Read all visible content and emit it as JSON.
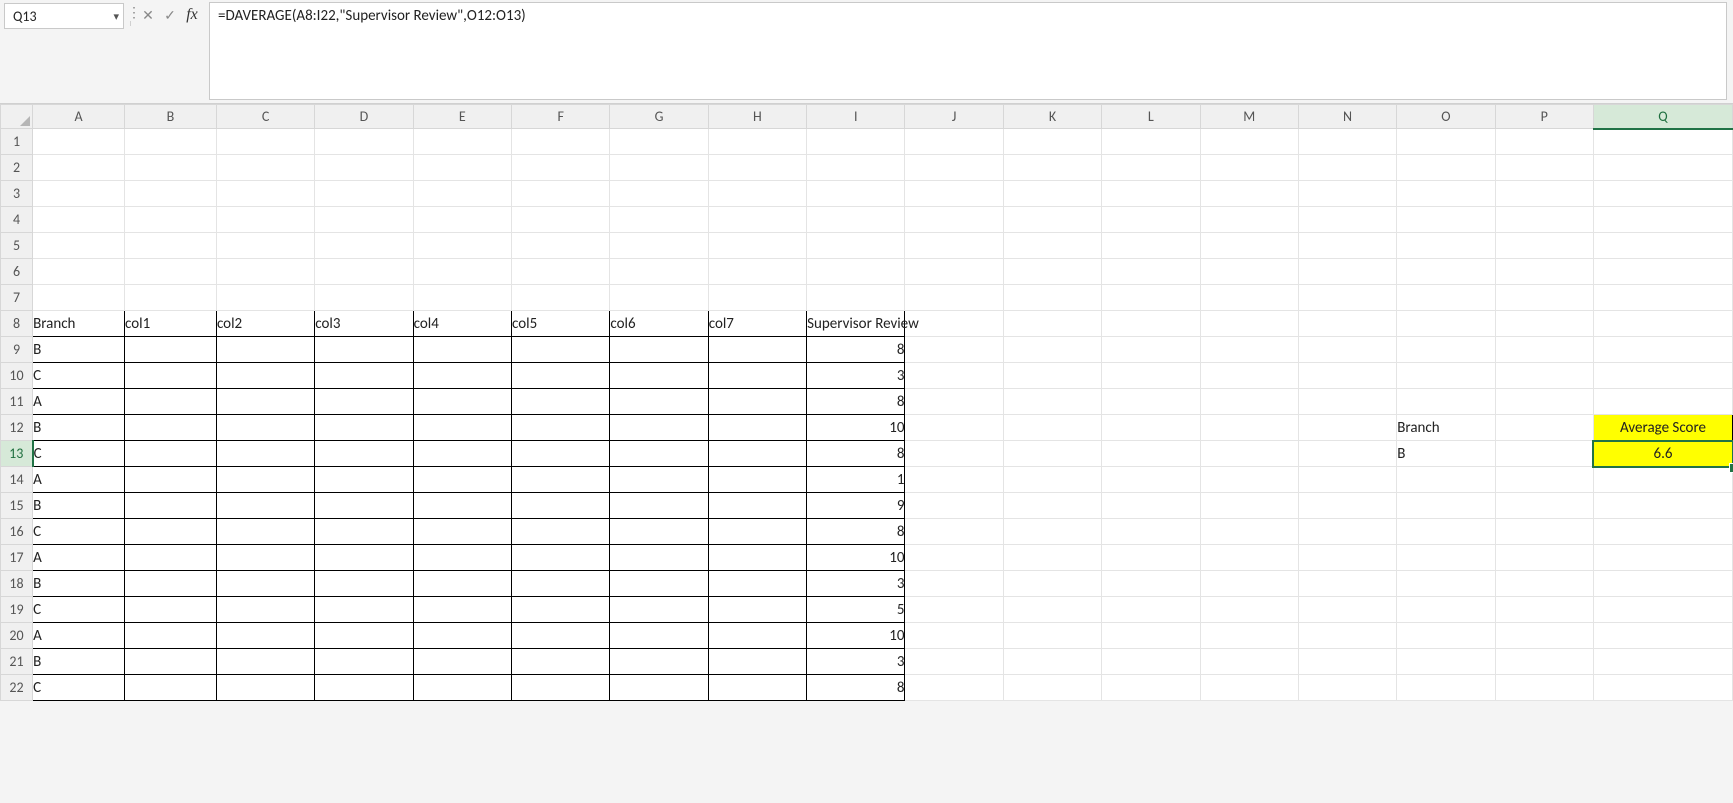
{
  "namebox": {
    "value": "Q13"
  },
  "formula_bar": {
    "cancel_glyph": "✕",
    "enter_glyph": "✓",
    "fx_label": "fx",
    "value": "=DAVERAGE(A8:I22,\"Supervisor Review\",O12:O13)"
  },
  "columns": [
    "A",
    "B",
    "C",
    "D",
    "E",
    "F",
    "G",
    "H",
    "I",
    "J",
    "K",
    "L",
    "M",
    "N",
    "O",
    "P",
    "Q"
  ],
  "selected_col": "Q",
  "row_labels": [
    "1",
    "2",
    "3",
    "4",
    "5",
    "6",
    "7",
    "8",
    "9",
    "10",
    "11",
    "12",
    "13",
    "14",
    "15",
    "16",
    "17",
    "18",
    "19",
    "20",
    "21",
    "22"
  ],
  "selected_row": "13",
  "headers": {
    "A": "Branch",
    "B": "col1",
    "C": "col2",
    "D": "col3",
    "E": "col4",
    "F": "col5",
    "G": "col6",
    "H": "col7",
    "I": "Supervisor Review"
  },
  "data_rows": [
    {
      "branch": "B",
      "review": "8"
    },
    {
      "branch": "C",
      "review": "3"
    },
    {
      "branch": "A",
      "review": "8"
    },
    {
      "branch": "B",
      "review": "10"
    },
    {
      "branch": "C",
      "review": "8"
    },
    {
      "branch": "A",
      "review": "1"
    },
    {
      "branch": "B",
      "review": "9"
    },
    {
      "branch": "C",
      "review": "8"
    },
    {
      "branch": "A",
      "review": "10"
    },
    {
      "branch": "B",
      "review": "3"
    },
    {
      "branch": "C",
      "review": "5"
    },
    {
      "branch": "A",
      "review": "10"
    },
    {
      "branch": "B",
      "review": "3"
    },
    {
      "branch": "C",
      "review": "8"
    }
  ],
  "criteria": {
    "label": "Branch",
    "value": "B"
  },
  "result": {
    "label": "Average Score",
    "value": "6.6"
  }
}
